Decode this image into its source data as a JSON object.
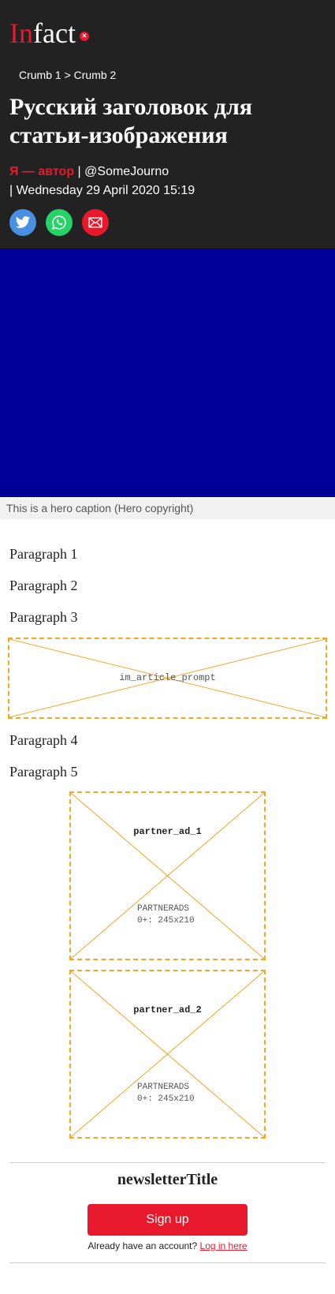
{
  "brand": {
    "logo_part_1": "In",
    "logo_part_2": "fact",
    "mark_color": "#e8192c"
  },
  "breadcrumb": {
    "crumb_1": "Crumb 1",
    "separator": ">",
    "crumb_2": "Crumb 2"
  },
  "article": {
    "headline": "Русский заголовок для статьи-изображения",
    "author": "Я — автор",
    "separator": "|",
    "twitter_handle": "@SomeJourno",
    "date": "Wednesday 29 April 2020 15:19"
  },
  "share": [
    {
      "icon": "twitter-icon",
      "color": "#4a90e2"
    },
    {
      "icon": "whatsapp-icon",
      "color": "#25d366"
    },
    {
      "icon": "email-icon",
      "color": "#e8192c"
    }
  ],
  "hero": {
    "color": "#000099",
    "caption": "This is a hero caption (Hero copyright)"
  },
  "body": {
    "paragraphs": [
      "Paragraph 1",
      "Paragraph 2",
      "Paragraph 3",
      "Paragraph 4",
      "Paragraph 5"
    ]
  },
  "ads": {
    "in_article": {
      "label": "im_article_prompt"
    },
    "partner_1": {
      "title": "partner_ad_1",
      "source": "PARTNERADS",
      "size": "0+: 245x210"
    },
    "partner_2": {
      "title": "partner_ad_2",
      "source": "PARTNERADS",
      "size": "0+: 245x210"
    }
  },
  "newsletter": {
    "title": "newsletterTitle",
    "signup_label": "Sign up",
    "login_prompt": "Already have an account?",
    "login_link": "Log in here"
  },
  "colors": {
    "accent": "#e8192c",
    "header_bg": "#222222",
    "ad_border": "#f5a623"
  }
}
